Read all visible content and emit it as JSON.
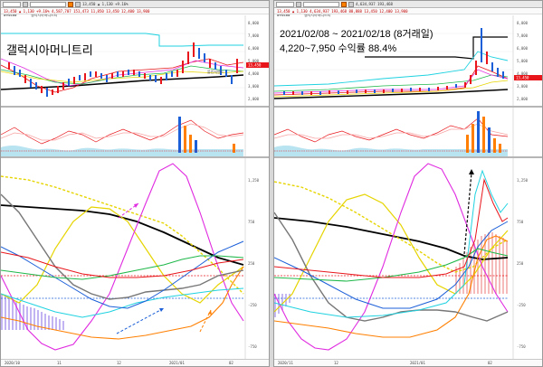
{
  "left": {
    "toolbar": {
      "code": "094480",
      "name": "갤럭시아머니트리",
      "quote": "13,450 ▲ 1,130 +9.16%"
    },
    "infobar": "13,450 ▲ 1,130 +9.16%  4,587,707  151,473 11,850  13,450  12,400  13,900",
    "annotation_title": "갤럭시아머니트리",
    "dates": [
      "2020/10",
      "11",
      "12",
      "2021/01",
      "02"
    ],
    "price_ticks": [
      "8,000",
      "7,000",
      "6,000",
      "5,000",
      "4,000",
      "3,000",
      "2,000"
    ],
    "osc_ticks": [
      "1,250",
      "750",
      "250",
      "-250",
      "-750"
    ],
    "price_flag": "13,450",
    "price_label_small": "볼린저밴드"
  },
  "right": {
    "toolbar": {
      "code": "094480",
      "name": "갤럭시아머니트리",
      "quote": "4,634,937  193,468"
    },
    "infobar": "13,450 ▲ 1,130  4,634,937  193,468  88,888  13,450  12,400  13,900",
    "annotation_line1": "2021/02/08 ~ 2021/02/18 (8거래일)",
    "annotation_line2": "4,220~7,950 수익률 88.4%",
    "dates": [
      "2020/11",
      "12",
      "2021/01",
      "02"
    ],
    "price_ticks": [
      "8,000",
      "7,000",
      "6,000",
      "5,000",
      "4,000",
      "3,000",
      "2,000"
    ],
    "osc_ticks": [
      "1,250",
      "750",
      "250",
      "-250",
      "-750"
    ],
    "price_flag": "13,450"
  },
  "colors": {
    "up": "#e8161b",
    "down": "#1b5fd8",
    "accent": "#ff7f00",
    "cyan": "#1fd2e0",
    "magenta": "#e02be0",
    "yellow": "#e6d400"
  }
}
